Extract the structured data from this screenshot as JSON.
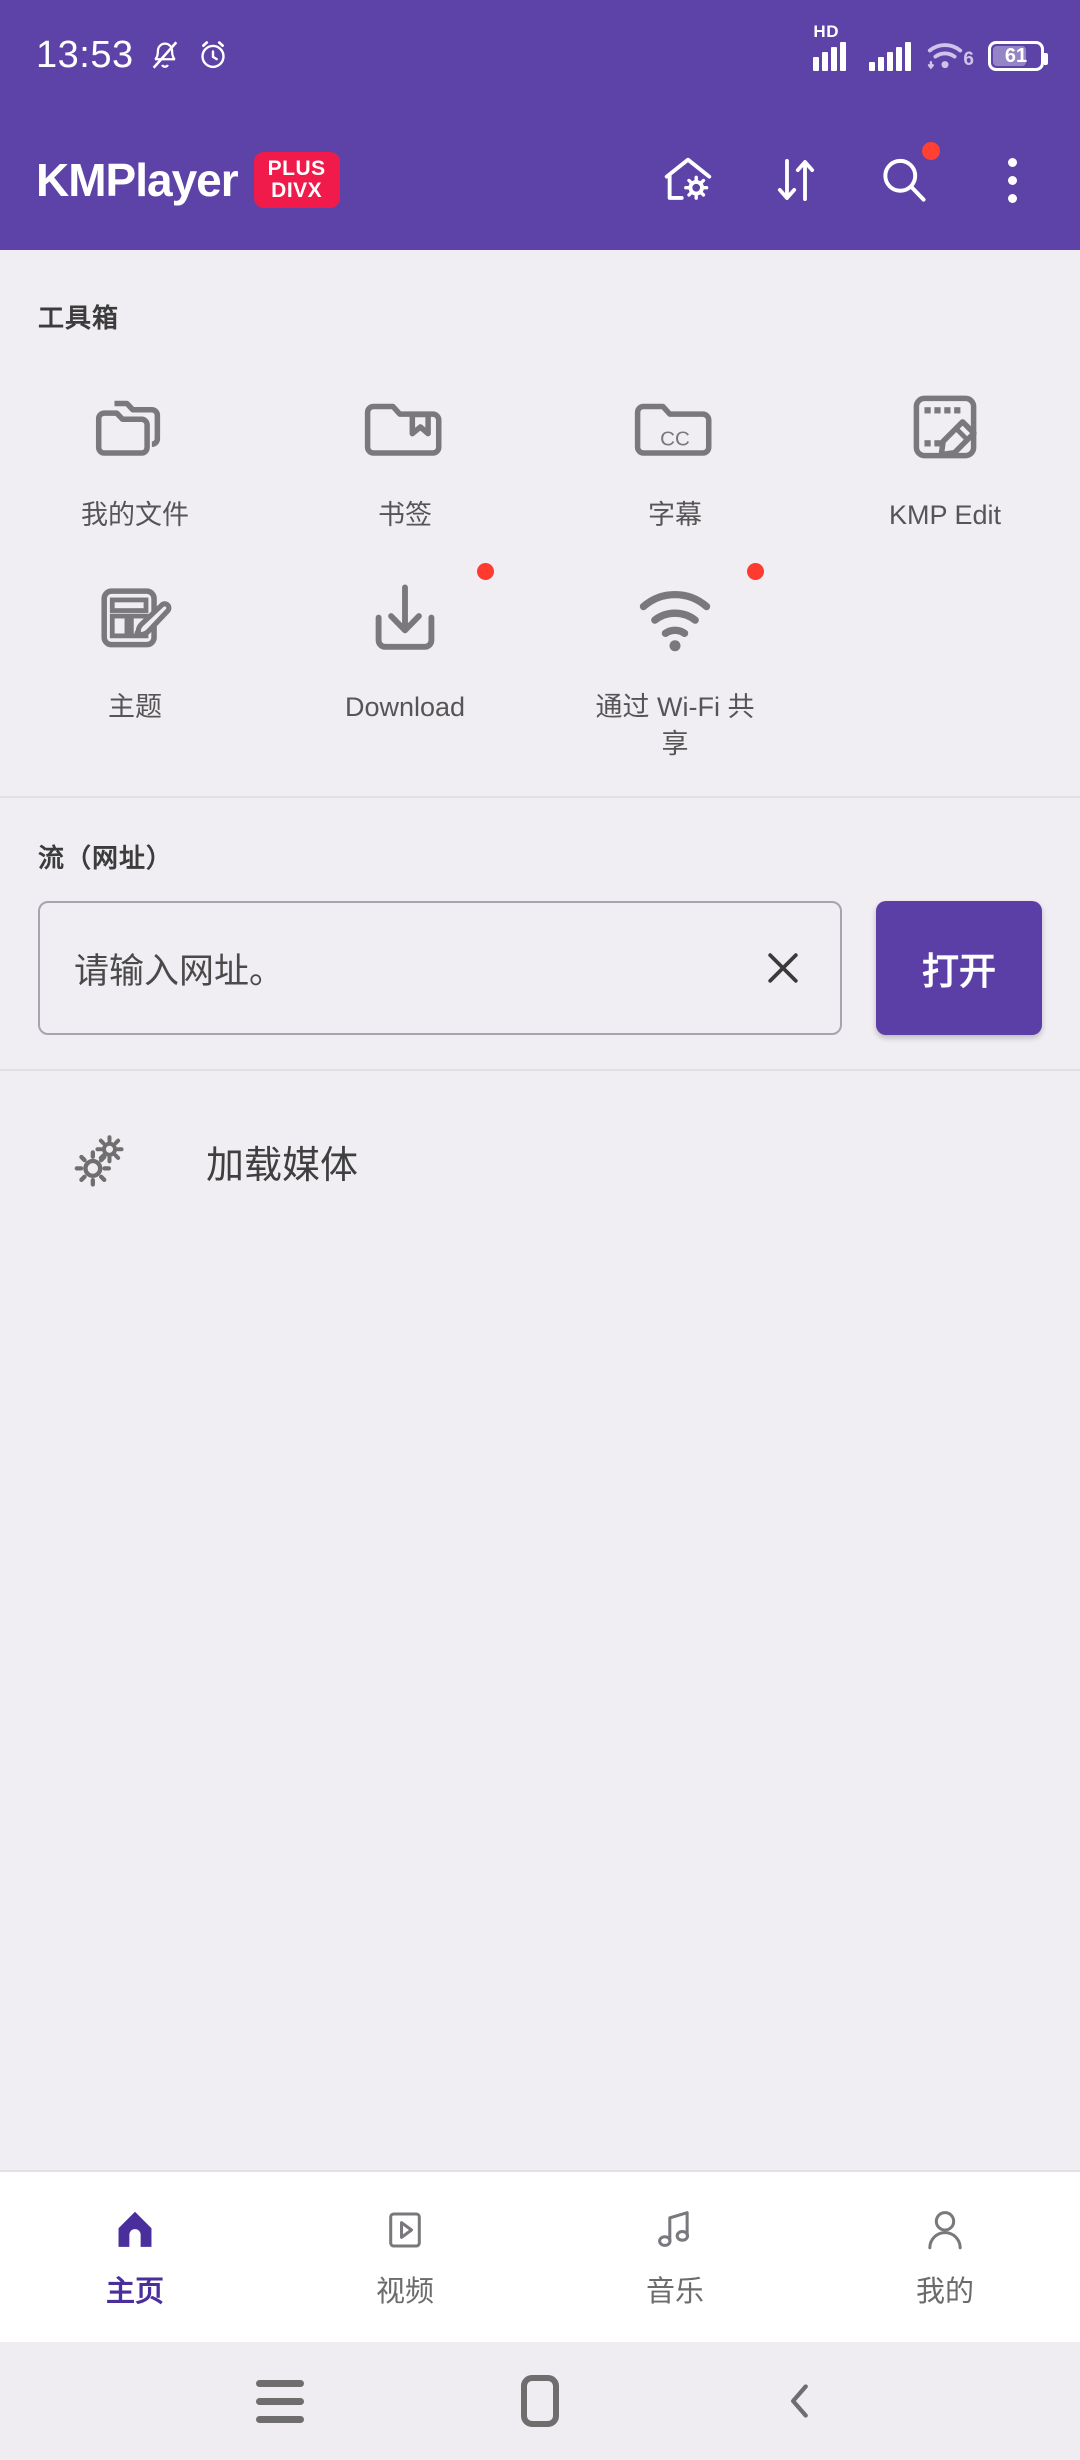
{
  "status_bar": {
    "time": "13:53",
    "icons": [
      "mute-icon",
      "alarm-icon"
    ],
    "network": {
      "hd_label": "HD",
      "wifi_generation": "6"
    },
    "battery": {
      "percent": "61"
    }
  },
  "app_bar": {
    "brand": "KMPlayer",
    "badge": {
      "line1": "PLUS",
      "line2": "DIVX",
      "color": "#f01b4a"
    },
    "actions": [
      {
        "name": "home-settings-icon",
        "has_badge": false
      },
      {
        "name": "sort-icon",
        "has_badge": false
      },
      {
        "name": "search-icon",
        "has_badge": true
      },
      {
        "name": "overflow-menu-icon",
        "has_badge": false
      }
    ],
    "accent": "#5d43a8"
  },
  "toolbox": {
    "title": "工具箱",
    "items": [
      {
        "label": "我的文件",
        "icon": "folders-icon",
        "badge": false
      },
      {
        "label": "书签",
        "icon": "bookmark-folder-icon",
        "badge": false
      },
      {
        "label": "字幕",
        "icon": "subtitle-cc-folder-icon",
        "badge": false
      },
      {
        "label": "KMP Edit",
        "icon": "film-edit-icon",
        "badge": false
      },
      {
        "label": "主题",
        "icon": "theme-palette-brush-icon",
        "badge": false
      },
      {
        "label": "Download",
        "icon": "download-icon",
        "badge": true
      },
      {
        "label": "通过 Wi-Fi 共享",
        "icon": "wifi-share-icon",
        "badge": true
      }
    ]
  },
  "stream": {
    "label": "流（网址）",
    "input_value": "",
    "placeholder": "请输入网址。",
    "clear_icon": "close-icon",
    "open_button": "打开",
    "open_button_color": "#5b3fa6"
  },
  "load_media": {
    "label": "加载媒体",
    "icon": "gears-icon"
  },
  "bottom_nav": {
    "active_color": "#4a2f9c",
    "items": [
      {
        "label": "主页",
        "icon": "home-icon",
        "active": true
      },
      {
        "label": "视频",
        "icon": "video-icon",
        "active": false
      },
      {
        "label": "音乐",
        "icon": "music-note-icon",
        "active": false
      },
      {
        "label": "我的",
        "icon": "person-icon",
        "active": false
      }
    ]
  },
  "system_nav": {
    "items": [
      {
        "name": "recents-button",
        "icon": "hamburger-icon"
      },
      {
        "name": "home-button",
        "icon": "rounded-square-icon"
      },
      {
        "name": "back-button",
        "icon": "chevron-left-icon"
      }
    ]
  }
}
